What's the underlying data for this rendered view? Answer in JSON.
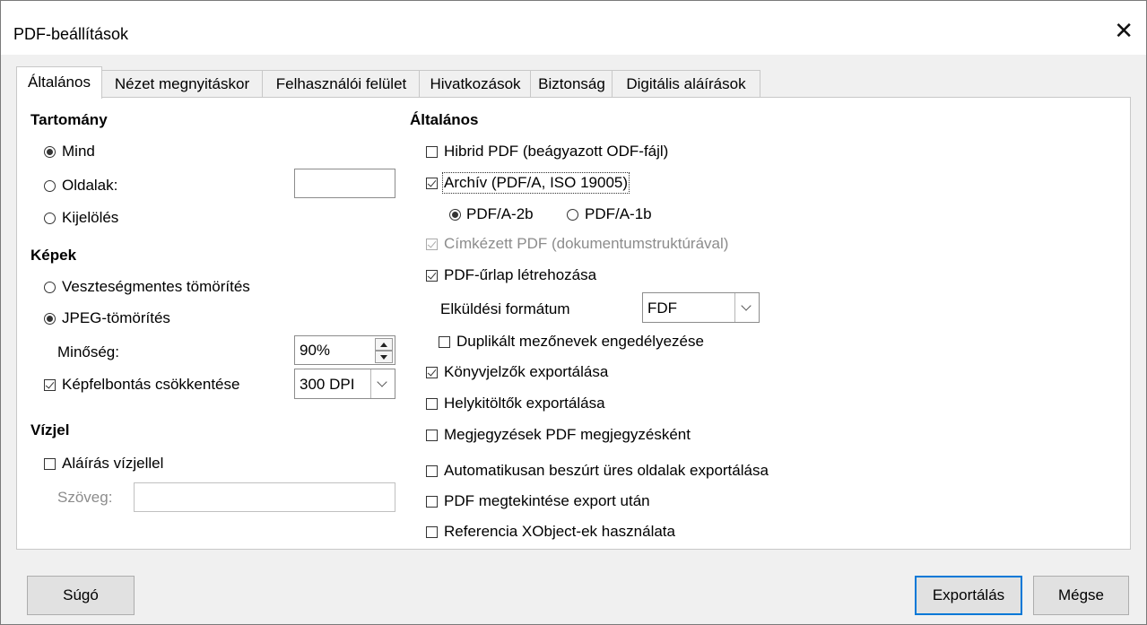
{
  "window": {
    "title": "PDF-beállítások",
    "close_glyph": "✕"
  },
  "tabs": [
    {
      "label": "Általános"
    },
    {
      "label": "Nézet megnyitáskor"
    },
    {
      "label": "Felhasználói felület"
    },
    {
      "label": "Hivatkozások"
    },
    {
      "label": "Biztonság"
    },
    {
      "label": "Digitális aláírások"
    }
  ],
  "range": {
    "header": "Tartomány",
    "all": "Mind",
    "pages": "Oldalak:",
    "pages_value": "",
    "selection": "Kijelölés",
    "selected": "all"
  },
  "images": {
    "header": "Képek",
    "lossless": "Veszteségmentes tömörítés",
    "jpeg": "JPEG-tömörítés",
    "selected": "jpeg",
    "quality_label": "Minőség:",
    "quality_value": "90%",
    "reduce_label": "Képfelbontás csökkentése",
    "reduce_checked": true,
    "dpi_value": "300 DPI"
  },
  "watermark": {
    "header": "Vízjel",
    "sign_label": "Aláírás vízjellel",
    "sign_checked": false,
    "text_label": "Szöveg:",
    "text_value": ""
  },
  "general": {
    "header": "Általános",
    "hybrid": "Hibrid PDF (beágyazott ODF-fájl)",
    "archive": "Archív (PDF/A, ISO 19005)",
    "pdfa2b": "PDF/A-2b",
    "pdfa1b": "PDF/A-1b",
    "tagged": "Címkézett PDF (dokumentumstruktúrával)",
    "form": "PDF-űrlap létrehozása",
    "submit_label": "Elküldési formátum",
    "submit_value": "FDF",
    "duplicate": "Duplikált mezőnevek engedélyezése",
    "bookmarks": "Könyvjelzők exportálása",
    "placeholders": "Helykitöltők exportálása",
    "comments": "Megjegyzések PDF megjegyzésként",
    "blank_pages": "Automatikusan beszúrt üres oldalak exportálása",
    "view_after": "PDF megtekintése export után",
    "xobject": "Referencia XObject-ek használata"
  },
  "buttons": {
    "help": "Súgó",
    "export": "Exportálás",
    "cancel": "Mégse"
  }
}
